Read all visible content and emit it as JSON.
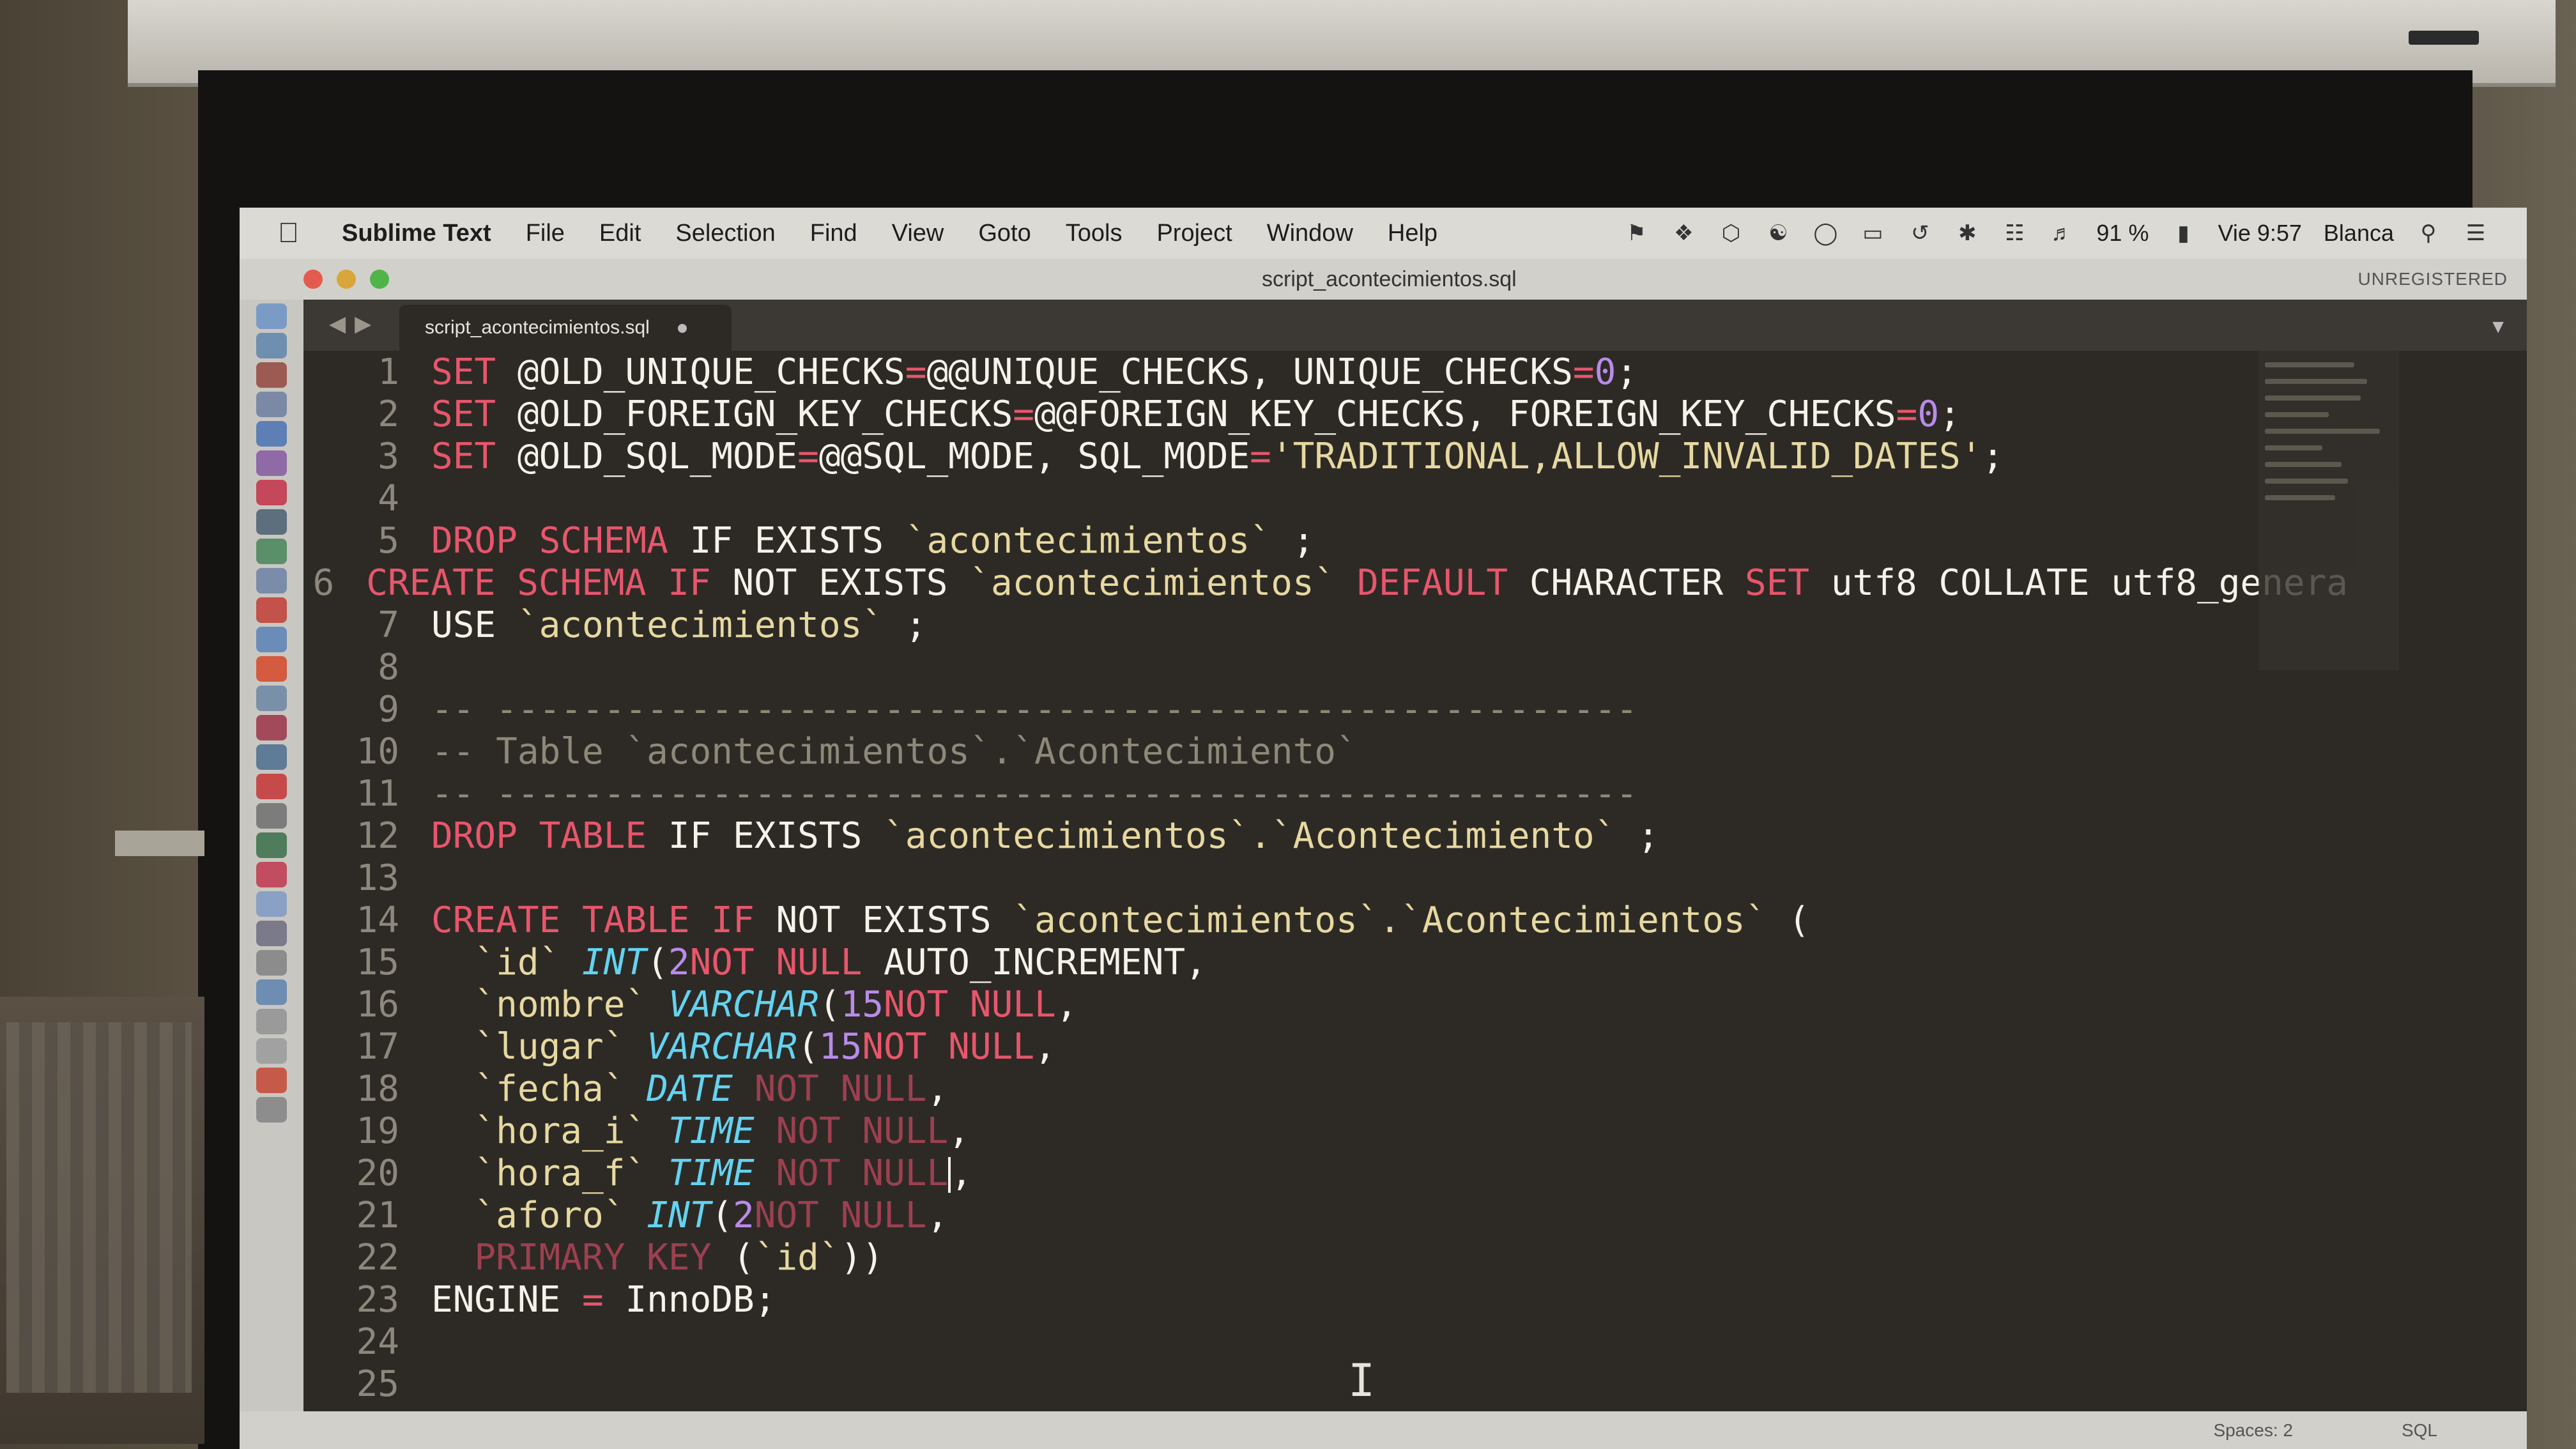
{
  "menubar": {
    "app_name": "Sublime Text",
    "items": [
      "File",
      "Edit",
      "Selection",
      "Find",
      "View",
      "Goto",
      "Tools",
      "Project",
      "Window",
      "Help"
    ],
    "battery": "91 %",
    "clock": "Vie 9:57",
    "user": "Blanca",
    "icons": [
      "flag-icon",
      "dropbox-icon",
      "box-icon",
      "evernote-icon",
      "timemachine-icon",
      "airplay-icon",
      "history-icon",
      "bluetooth-icon",
      "wifi-icon",
      "volume-icon",
      "battery-icon",
      "search-icon",
      "list-icon"
    ]
  },
  "window": {
    "title": "script_acontecimientos.sql",
    "registration": "UNREGISTERED"
  },
  "tab": {
    "label": "script_acontecimientos.sql"
  },
  "editor": {
    "lines": [
      {
        "n": "1",
        "t": [
          [
            "kw-pink",
            "SET "
          ],
          [
            "",
            "@OLD_UNIQUE_CHECKS"
          ],
          [
            "eq",
            "="
          ],
          [
            "",
            "@@UNIQUE_CHECKS, UNIQUE_CHECKS"
          ],
          [
            "eq",
            "="
          ],
          [
            "num",
            "0"
          ],
          [
            "",
            ";"
          ]
        ]
      },
      {
        "n": "2",
        "t": [
          [
            "kw-pink",
            "SET "
          ],
          [
            "",
            "@OLD_FOREIGN_KEY_CHECKS"
          ],
          [
            "eq",
            "="
          ],
          [
            "",
            "@@FOREIGN_KEY_CHECKS, FOREIGN_KEY_CHECKS"
          ],
          [
            "eq",
            "="
          ],
          [
            "num",
            "0"
          ],
          [
            "",
            ";"
          ]
        ]
      },
      {
        "n": "3",
        "t": [
          [
            "kw-pink",
            "SET "
          ],
          [
            "",
            "@OLD_SQL_MODE"
          ],
          [
            "eq",
            "="
          ],
          [
            "",
            "@@SQL_MODE, SQL_MODE"
          ],
          [
            "eq",
            "="
          ],
          [
            "str",
            "'TRADITIONAL,ALLOW_INVALID_DATES'"
          ],
          [
            "",
            ";"
          ]
        ]
      },
      {
        "n": "4",
        "t": []
      },
      {
        "n": "5",
        "t": [
          [
            "kw-pink",
            "DROP SCHEMA "
          ],
          [
            "",
            "IF EXISTS "
          ],
          [
            "str",
            "`acontecimientos`"
          ],
          [
            "",
            " ;"
          ]
        ]
      },
      {
        "n": "6",
        "t": [
          [
            "kw-pink",
            "CREATE SCHEMA "
          ],
          [
            "kw-pink",
            "IF "
          ],
          [
            "",
            "NOT EXISTS "
          ],
          [
            "str",
            "`acontecimientos`"
          ],
          [
            "kw-pink",
            " DEFAULT "
          ],
          [
            "",
            "CHARACTER "
          ],
          [
            "kw-pink",
            "SET "
          ],
          [
            "",
            "utf8 COLLATE utf8_genera"
          ]
        ]
      },
      {
        "n": "7",
        "t": [
          [
            "",
            "USE "
          ],
          [
            "str",
            "`acontecimientos`"
          ],
          [
            "",
            " ;"
          ]
        ]
      },
      {
        "n": "8",
        "t": []
      },
      {
        "n": "9",
        "t": [
          [
            "cmt",
            "-- -----------------------------------------------------"
          ]
        ]
      },
      {
        "n": "10",
        "t": [
          [
            "cmt",
            "-- Table `acontecimientos`.`Acontecimiento`"
          ]
        ]
      },
      {
        "n": "11",
        "t": [
          [
            "cmt",
            "-- -----------------------------------------------------"
          ]
        ]
      },
      {
        "n": "12",
        "t": [
          [
            "kw-pink",
            "DROP TABLE "
          ],
          [
            "",
            "IF EXISTS "
          ],
          [
            "str",
            "`acontecimientos`.`Acontecimiento`"
          ],
          [
            "",
            " ;"
          ]
        ]
      },
      {
        "n": "13",
        "t": []
      },
      {
        "n": "14",
        "t": [
          [
            "kw-pink",
            "CREATE TABLE "
          ],
          [
            "kw-pink",
            "IF "
          ],
          [
            "",
            "NOT EXISTS "
          ],
          [
            "str",
            "`acontecimientos`.`Acontecimientos`"
          ],
          [
            "",
            " ("
          ]
        ]
      },
      {
        "n": "15",
        "t": [
          [
            "str",
            "  `id`"
          ],
          [
            "typ",
            " INT"
          ],
          [
            "",
            "("
          ],
          [
            "num",
            "2"
          ],
          [
            ") "
          ],
          [
            "kw-pink",
            "NOT NULL "
          ],
          [
            "",
            "AUTO_INCREMENT,"
          ]
        ]
      },
      {
        "n": "16",
        "t": [
          [
            "str",
            "  `nombre`"
          ],
          [
            "typ",
            " VARCHAR"
          ],
          [
            "",
            "("
          ],
          [
            "num",
            "15"
          ],
          [
            ") "
          ],
          [
            "kw-pink",
            "NOT NULL"
          ],
          [
            "",
            ","
          ]
        ]
      },
      {
        "n": "17",
        "t": [
          [
            "str",
            "  `lugar`"
          ],
          [
            "typ",
            " VARCHAR"
          ],
          [
            "",
            "("
          ],
          [
            "num",
            "15"
          ],
          [
            ") "
          ],
          [
            "kw-pink",
            "NOT NULL"
          ],
          [
            "",
            ","
          ]
        ]
      },
      {
        "n": "18",
        "t": [
          [
            "str",
            "  `fecha`"
          ],
          [
            "typ",
            " DATE "
          ],
          [
            "kw-dim",
            "NOT NULL"
          ],
          [
            "",
            ","
          ]
        ]
      },
      {
        "n": "19",
        "t": [
          [
            "str",
            "  `hora_i`"
          ],
          [
            "typ",
            " TIME "
          ],
          [
            "kw-dim",
            "NOT NULL"
          ],
          [
            "",
            ","
          ]
        ]
      },
      {
        "n": "20",
        "t": [
          [
            "str",
            "  `hora_f`"
          ],
          [
            "typ",
            " TIME "
          ],
          [
            "kw-dim",
            "NOT NULL"
          ],
          [
            "cursor",
            ""
          ],
          [
            "",
            ","
          ]
        ]
      },
      {
        "n": "21",
        "t": [
          [
            "str",
            "  `aforo`"
          ],
          [
            "typ",
            " INT"
          ],
          [
            "",
            "("
          ],
          [
            "num",
            "2"
          ],
          [
            ") "
          ],
          [
            "kw-dim",
            "NOT NULL"
          ],
          [
            "",
            ","
          ]
        ]
      },
      {
        "n": "22",
        "t": [
          [
            "kw-dim",
            "  PRIMARY KEY "
          ],
          [
            "",
            "("
          ],
          [
            "str",
            "`id`"
          ],
          [
            "",
            "))"
          ]
        ]
      },
      {
        "n": "23",
        "t": [
          [
            "",
            "ENGINE "
          ],
          [
            "eq",
            "= "
          ],
          [
            "",
            "InnoDB;"
          ]
        ]
      },
      {
        "n": "24",
        "t": []
      },
      {
        "n": "25",
        "t": []
      }
    ]
  },
  "statusbar": {
    "spaces": "Spaces: 2",
    "syntax": "SQL"
  },
  "colors": {
    "editor_bg": "#2d2a26",
    "keyword": "#e8566b",
    "string": "#e6d8a0",
    "number": "#b98be9",
    "type": "#64d3f0",
    "comment": "#8e8878"
  }
}
